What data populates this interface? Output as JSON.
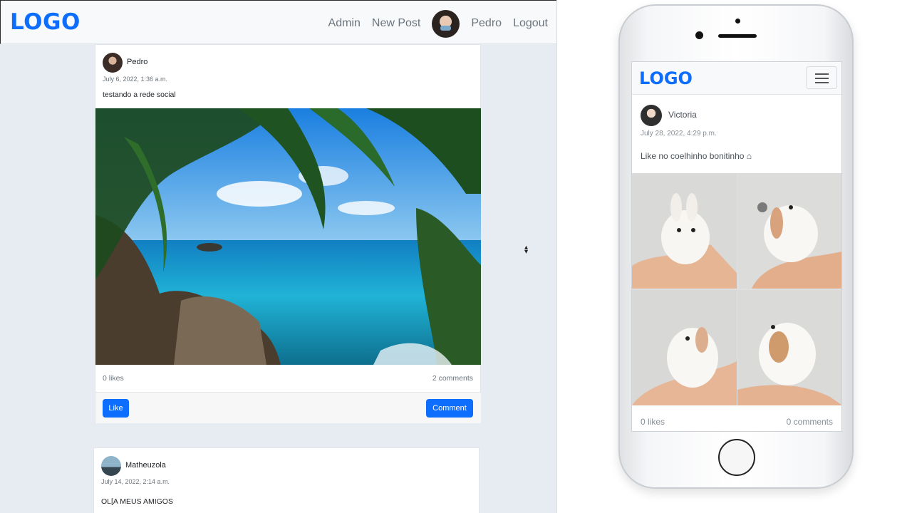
{
  "desktop": {
    "brand": "LOGO",
    "nav": {
      "admin": "Admin",
      "new_post": "New Post",
      "user": "Pedro",
      "logout": "Logout"
    },
    "posts": [
      {
        "author": "Pedro",
        "date": "July 6, 2022, 1:36 a.m.",
        "text": "testando a rede social",
        "likes": "0 likes",
        "comments": "2 comments",
        "like_label": "Like",
        "comment_label": "Comment"
      },
      {
        "author": "Matheuzola",
        "date": "July 14, 2022, 2:14 a.m.",
        "text": "OL[A MEUS AMIGOS"
      }
    ]
  },
  "phone": {
    "brand": "LOGO",
    "post": {
      "author": "Victoria",
      "date": "July 28, 2022, 4:29 p.m.",
      "text": "Like no coelhinho bonitinho",
      "likes": "0 likes",
      "comments": "0 comments"
    }
  },
  "colors": {
    "primary": "#0d6efd",
    "background": "#e7ebf2"
  }
}
